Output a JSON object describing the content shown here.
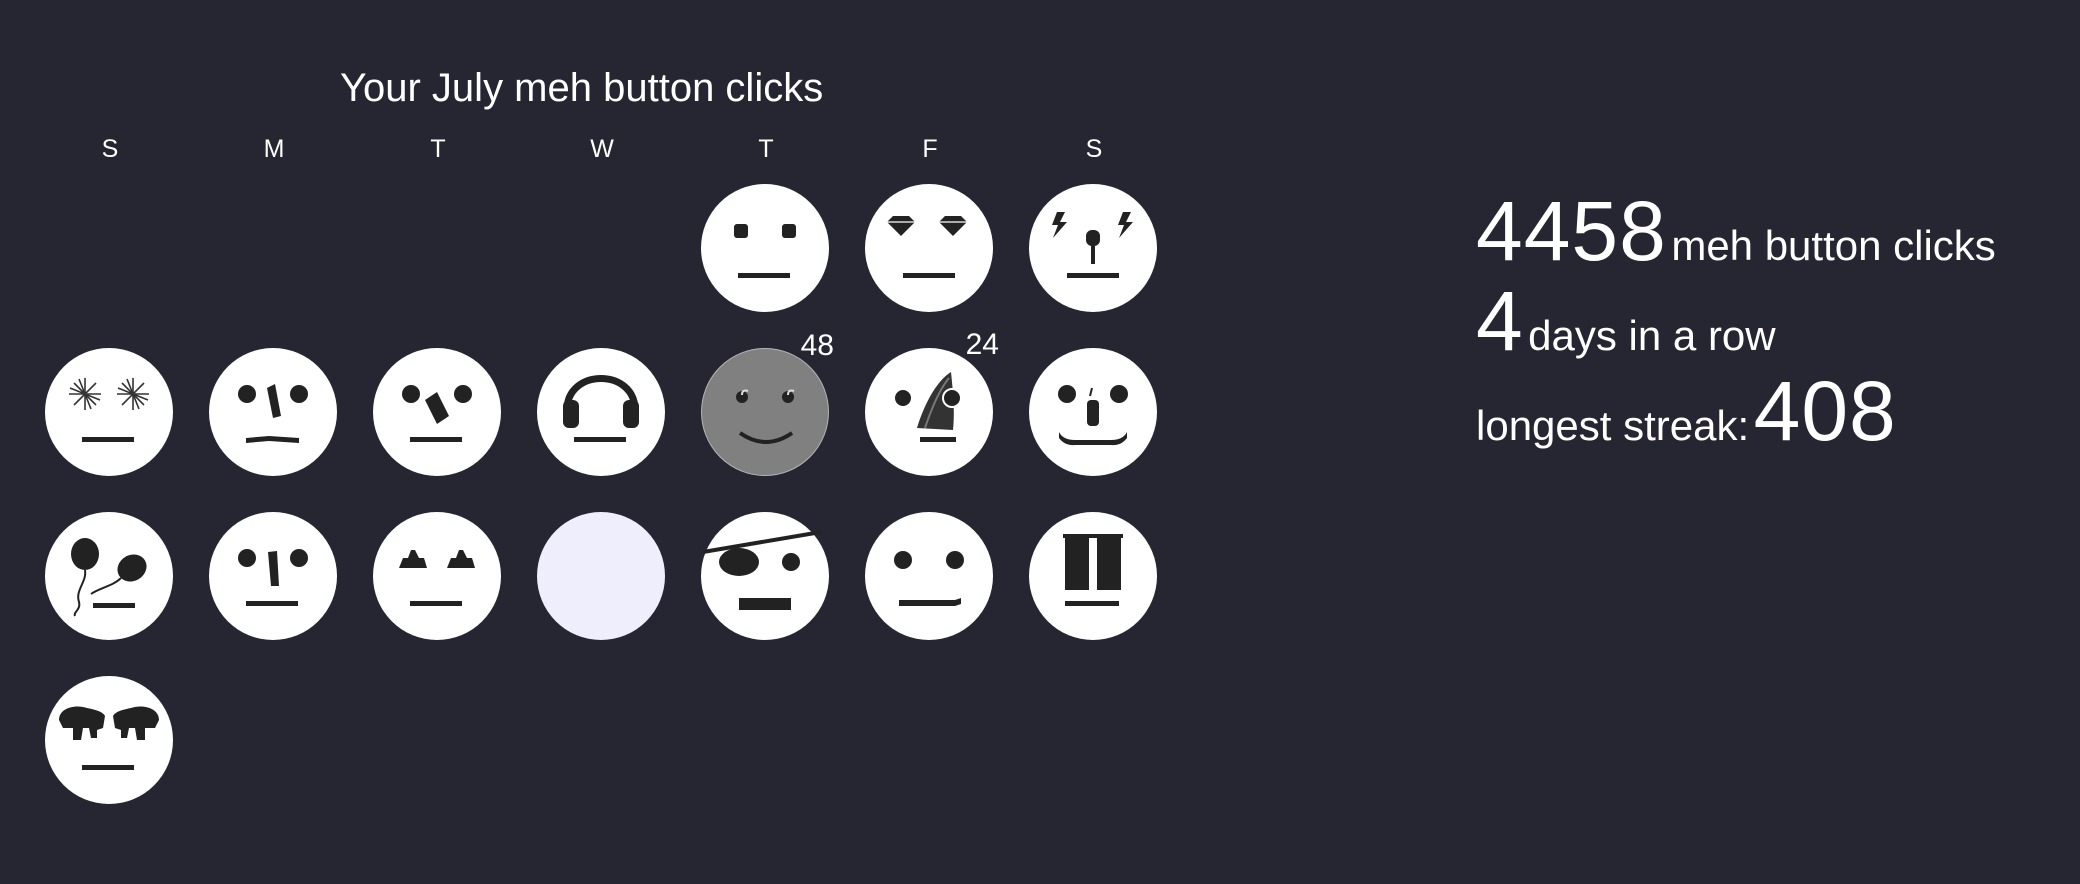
{
  "calendar": {
    "title": "Your July meh button clicks",
    "weekdays": [
      "S",
      "M",
      "T",
      "W",
      "T",
      "F",
      "S"
    ],
    "days": [
      {
        "variant": "square-eyes",
        "state": "past"
      },
      {
        "variant": "diamond-eyes",
        "state": "past"
      },
      {
        "variant": "lightning-microphone",
        "state": "past"
      },
      {
        "variant": "fireworks-eyes",
        "state": "past"
      },
      {
        "variant": "crooked-nose",
        "state": "past"
      },
      {
        "variant": "slanted-nose",
        "state": "past"
      },
      {
        "variant": "headphones",
        "state": "past"
      },
      {
        "variant": "smiling-grey",
        "state": "today",
        "count": "48"
      },
      {
        "variant": "comet",
        "state": "past",
        "count": "24"
      },
      {
        "variant": "mustache",
        "state": "past"
      },
      {
        "variant": "balloon-eyes",
        "state": "past"
      },
      {
        "variant": "plain-nose",
        "state": "past"
      },
      {
        "variant": "triangle-eyes",
        "state": "past"
      },
      {
        "variant": "blank",
        "state": "future"
      },
      {
        "variant": "eye-patch",
        "state": "past"
      },
      {
        "variant": "cigarette",
        "state": "past"
      },
      {
        "variant": "curtains",
        "state": "past"
      },
      {
        "variant": "hands-eyes",
        "state": "past"
      }
    ]
  },
  "stats": {
    "total_clicks": "4458",
    "total_clicks_label": "meh button clicks",
    "streak_days": "4",
    "streak_label": "days in a row",
    "longest_label": "longest streak:",
    "longest_value": "408"
  }
}
